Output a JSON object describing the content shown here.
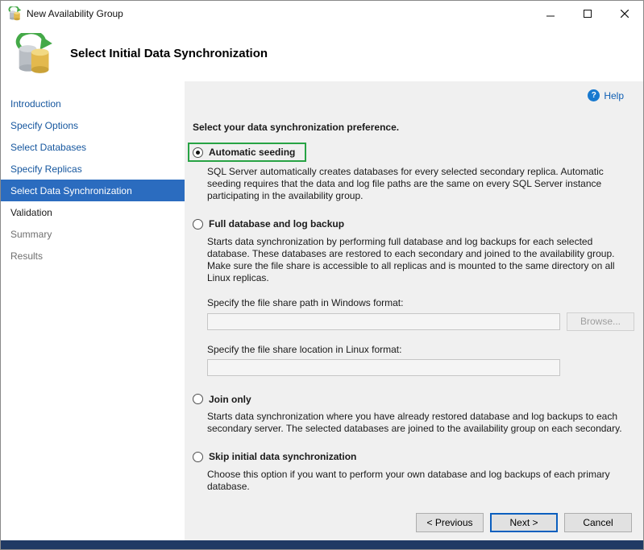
{
  "window": {
    "title": "New Availability Group"
  },
  "header": {
    "title": "Select Initial Data Synchronization"
  },
  "sidebar": {
    "items": [
      {
        "label": "Introduction",
        "state": "link"
      },
      {
        "label": "Specify Options",
        "state": "link"
      },
      {
        "label": "Select Databases",
        "state": "link"
      },
      {
        "label": "Specify Replicas",
        "state": "link"
      },
      {
        "label": "Select Data Synchronization",
        "state": "active"
      },
      {
        "label": "Validation",
        "state": "enabled"
      },
      {
        "label": "Summary",
        "state": "pending"
      },
      {
        "label": "Results",
        "state": "pending"
      }
    ]
  },
  "main": {
    "help_label": "Help",
    "help_icon_glyph": "?",
    "heading": "Select your data synchronization preference.",
    "options": [
      {
        "label": "Automatic seeding",
        "selected": true,
        "description": "SQL Server automatically creates databases for every selected secondary replica. Automatic seeding requires that the data and log file paths are the same on every SQL Server instance participating in the availability group."
      },
      {
        "label": "Full database and log backup",
        "selected": false,
        "description": "Starts data synchronization by performing full database and log backups for each selected database. These databases are restored to each secondary and joined to the availability group. Make sure the file share is accessible to all replicas and is mounted to the same directory on all Linux replicas.",
        "fields": [
          {
            "label": "Specify the file share path in Windows format:",
            "value": "",
            "browse": "Browse..."
          },
          {
            "label": "Specify the file share location in Linux format:",
            "value": ""
          }
        ]
      },
      {
        "label": "Join only",
        "selected": false,
        "description": "Starts data synchronization where you have already restored database and log backups to each secondary server. The selected databases are joined to the availability group on each secondary."
      },
      {
        "label": "Skip initial data synchronization",
        "selected": false,
        "description": "Choose this option if you want to perform your own database and log backups of each primary database."
      }
    ]
  },
  "footer": {
    "previous_label": "< Previous",
    "next_label": "Next >",
    "cancel_label": "Cancel"
  },
  "colors": {
    "highlight_green": "#27a344",
    "active_step_blue": "#2b6cbf",
    "link_blue": "#15569e",
    "next_button_border": "#0c5fbe",
    "main_background": "#f0f0f0"
  }
}
